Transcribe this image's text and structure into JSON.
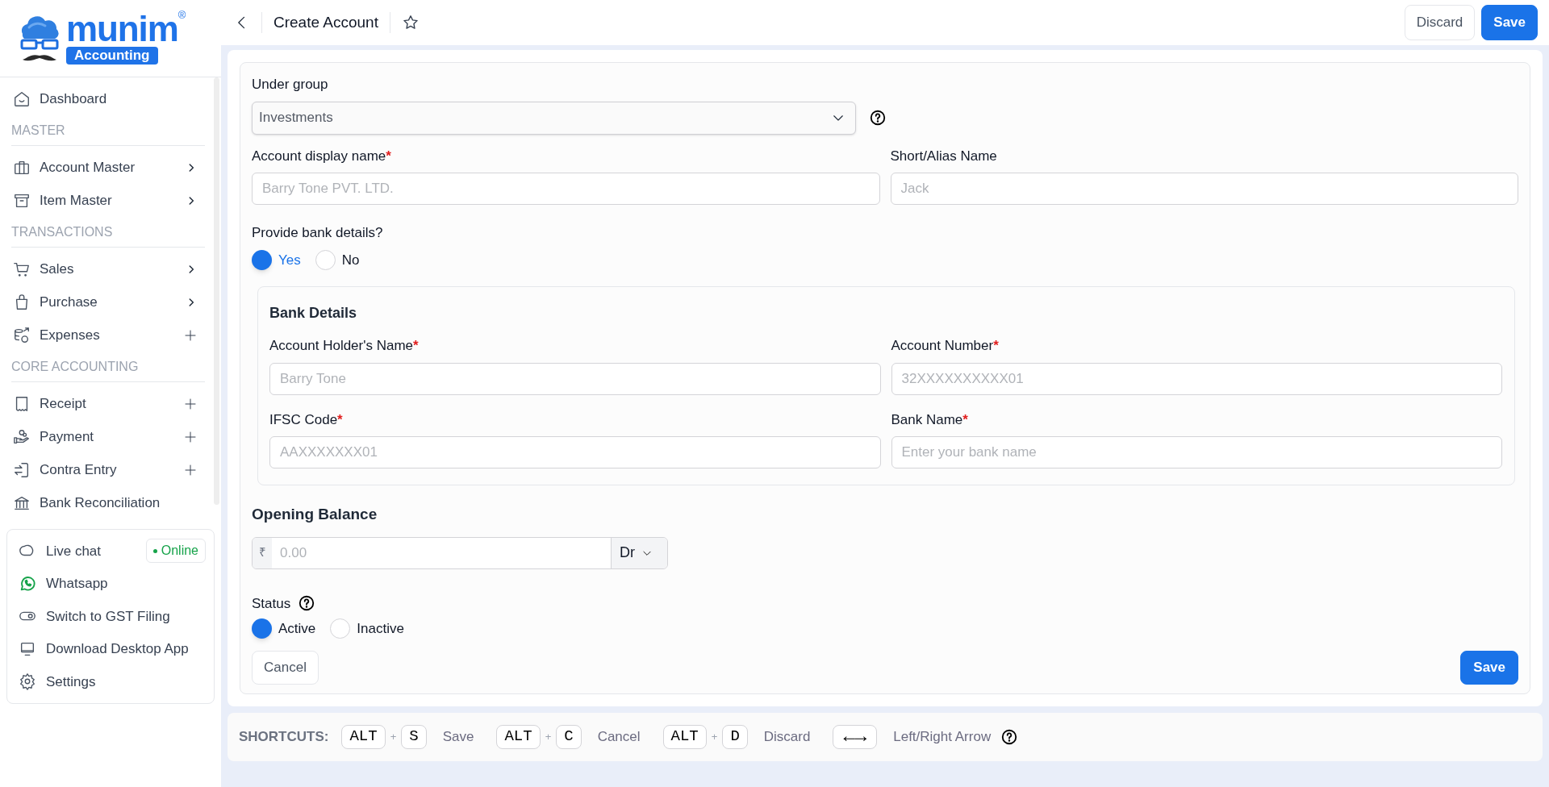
{
  "sidebar": {
    "logo": {
      "name": "munim",
      "registered": "®",
      "tagline": "Accounting"
    },
    "sections": [
      {
        "items": [
          {
            "label": "Dashboard",
            "kind": "link"
          }
        ]
      },
      {
        "heading": "MASTER",
        "items": [
          {
            "label": "Account Master",
            "kind": "submenu"
          },
          {
            "label": "Item Master",
            "kind": "submenu"
          }
        ]
      },
      {
        "heading": "TRANSACTIONS",
        "items": [
          {
            "label": "Sales",
            "kind": "submenu"
          },
          {
            "label": "Purchase",
            "kind": "submenu"
          },
          {
            "label": "Expenses",
            "kind": "create"
          }
        ]
      },
      {
        "heading": "CORE ACCOUNTING",
        "items": [
          {
            "label": "Receipt",
            "kind": "create"
          },
          {
            "label": "Payment",
            "kind": "create"
          },
          {
            "label": "Contra Entry",
            "kind": "create"
          },
          {
            "label": "Bank Reconciliation",
            "kind": "link"
          }
        ]
      }
    ],
    "help": [
      {
        "label": "Live chat",
        "badge": "Online"
      },
      {
        "label": "Whatsapp"
      },
      {
        "label": "Switch to GST Filing"
      },
      {
        "label": "Download Desktop App"
      },
      {
        "label": "Settings"
      }
    ]
  },
  "header": {
    "title": "Create Account",
    "buttons": [
      {
        "label": "Discard",
        "kind": "secondary"
      },
      {
        "label": "Save",
        "kind": "primary"
      }
    ]
  },
  "form": {
    "under_group": {
      "label": "Under group",
      "value": "Investments"
    },
    "name_fields": [
      {
        "label": "Account display name",
        "required_mark": "*",
        "placeholder": "Barry Tone PVT. LTD."
      },
      {
        "label": "Short/Alias Name",
        "placeholder": "Jack"
      }
    ],
    "bank_toggle": {
      "label": "Provide bank details?",
      "options": [
        {
          "label": "Yes",
          "selected": true
        },
        {
          "label": "No",
          "selected": false
        }
      ]
    },
    "bank_details": {
      "title": "Bank Details",
      "fields": [
        {
          "label": "Account Holder's Name",
          "required_mark": "*",
          "placeholder": "Barry Tone"
        },
        {
          "label": "Account Number",
          "required_mark": "*",
          "placeholder": "32XXXXXXXXXX01"
        },
        {
          "label": "IFSC Code",
          "required_mark": "*",
          "placeholder": "AAXXXXXXX01"
        },
        {
          "label": "Bank Name",
          "required_mark": "*",
          "placeholder": "Enter your bank name"
        }
      ]
    },
    "opening_balance": {
      "title": "Opening Balance",
      "currency": "₹",
      "placeholder": "0.00",
      "type": "Dr"
    },
    "status": {
      "label": "Status",
      "options": [
        {
          "label": "Active",
          "selected": true
        },
        {
          "label": "Inactive",
          "selected": false
        }
      ]
    },
    "buttons": [
      {
        "label": "Cancel",
        "kind": "secondary"
      },
      {
        "label": "Save",
        "kind": "primary"
      }
    ]
  },
  "shortcuts": {
    "title": "SHORTCUTS:",
    "items": [
      {
        "keys": [
          "ALT",
          "S"
        ],
        "joiner": "+",
        "label": "Save"
      },
      {
        "keys": [
          "ALT",
          "C"
        ],
        "joiner": "+",
        "label": "Cancel"
      },
      {
        "keys": [
          "ALT",
          "D"
        ],
        "joiner": "+",
        "label": "Discard"
      },
      {
        "keys": [
          "←→"
        ],
        "label": "Left/Right Arrow"
      }
    ]
  }
}
